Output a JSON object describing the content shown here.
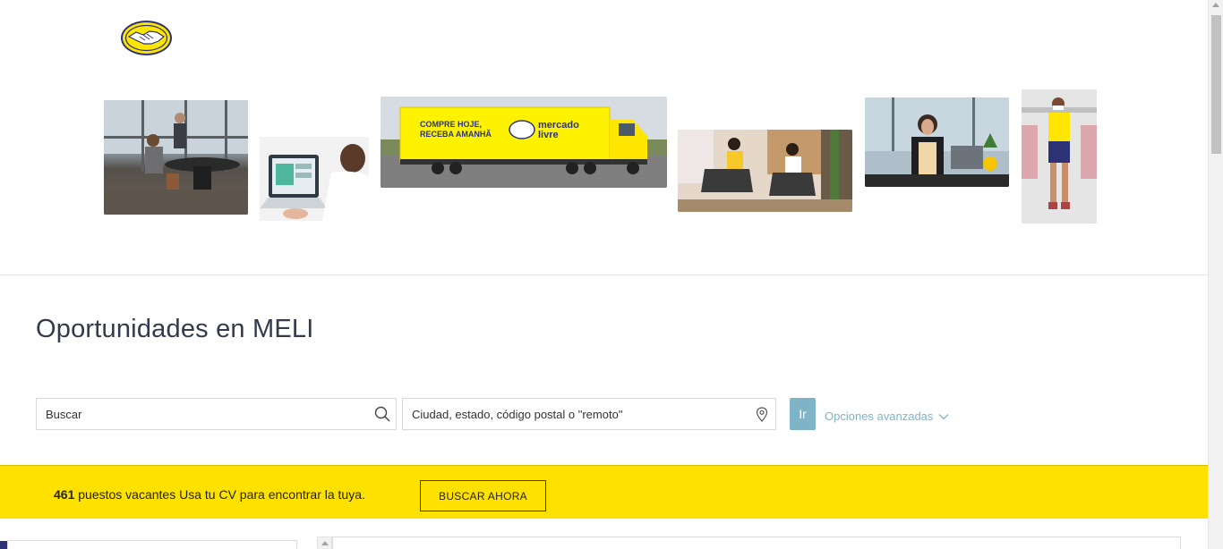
{
  "header": {
    "logo_name": "mercado-libre-handshake-logo"
  },
  "main": {
    "title": "Oportunidades en MELI"
  },
  "search": {
    "keyword_placeholder": "Buscar",
    "location_placeholder": "Ciudad, estado, código postal o \"remoto\"",
    "go_label": "Ir",
    "advanced_label": "Opciones avanzadas"
  },
  "banner": {
    "count": "461",
    "count_label": "puestos vacantes",
    "message": "Usa tu CV para encontrar la tuya.",
    "cta_label": "BUSCAR AHORA"
  },
  "hero": {
    "truck_text_line1": "COMPRE HOJE,",
    "truck_text_line2": "RECEBA AMANHÃ",
    "truck_brand_line1": "mercado",
    "truck_brand_line2": "livre"
  },
  "colors": {
    "brand_yellow": "#ffe100",
    "accent_blue": "#7fb4c8",
    "title_color": "#333b4b",
    "logo_navy": "#2d3277"
  }
}
